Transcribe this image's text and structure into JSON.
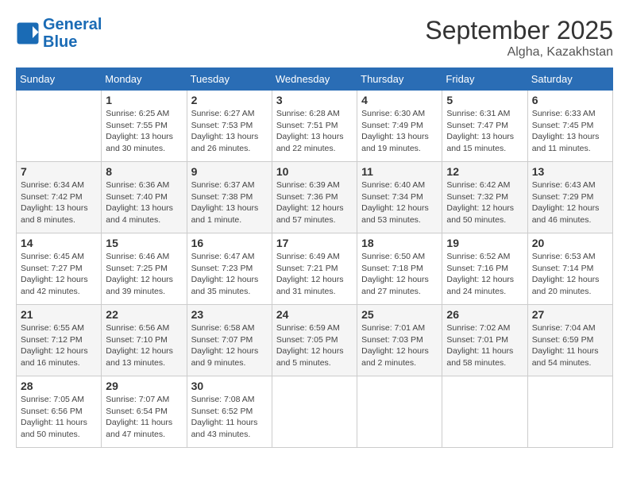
{
  "header": {
    "logo_line1": "General",
    "logo_line2": "Blue",
    "month_title": "September 2025",
    "location": "Algha, Kazakhstan"
  },
  "days_of_week": [
    "Sunday",
    "Monday",
    "Tuesday",
    "Wednesday",
    "Thursday",
    "Friday",
    "Saturday"
  ],
  "weeks": [
    [
      {
        "day": "",
        "info": ""
      },
      {
        "day": "1",
        "info": "Sunrise: 6:25 AM\nSunset: 7:55 PM\nDaylight: 13 hours\nand 30 minutes."
      },
      {
        "day": "2",
        "info": "Sunrise: 6:27 AM\nSunset: 7:53 PM\nDaylight: 13 hours\nand 26 minutes."
      },
      {
        "day": "3",
        "info": "Sunrise: 6:28 AM\nSunset: 7:51 PM\nDaylight: 13 hours\nand 22 minutes."
      },
      {
        "day": "4",
        "info": "Sunrise: 6:30 AM\nSunset: 7:49 PM\nDaylight: 13 hours\nand 19 minutes."
      },
      {
        "day": "5",
        "info": "Sunrise: 6:31 AM\nSunset: 7:47 PM\nDaylight: 13 hours\nand 15 minutes."
      },
      {
        "day": "6",
        "info": "Sunrise: 6:33 AM\nSunset: 7:45 PM\nDaylight: 13 hours\nand 11 minutes."
      }
    ],
    [
      {
        "day": "7",
        "info": "Sunrise: 6:34 AM\nSunset: 7:42 PM\nDaylight: 13 hours\nand 8 minutes."
      },
      {
        "day": "8",
        "info": "Sunrise: 6:36 AM\nSunset: 7:40 PM\nDaylight: 13 hours\nand 4 minutes."
      },
      {
        "day": "9",
        "info": "Sunrise: 6:37 AM\nSunset: 7:38 PM\nDaylight: 13 hours\nand 1 minute."
      },
      {
        "day": "10",
        "info": "Sunrise: 6:39 AM\nSunset: 7:36 PM\nDaylight: 12 hours\nand 57 minutes."
      },
      {
        "day": "11",
        "info": "Sunrise: 6:40 AM\nSunset: 7:34 PM\nDaylight: 12 hours\nand 53 minutes."
      },
      {
        "day": "12",
        "info": "Sunrise: 6:42 AM\nSunset: 7:32 PM\nDaylight: 12 hours\nand 50 minutes."
      },
      {
        "day": "13",
        "info": "Sunrise: 6:43 AM\nSunset: 7:29 PM\nDaylight: 12 hours\nand 46 minutes."
      }
    ],
    [
      {
        "day": "14",
        "info": "Sunrise: 6:45 AM\nSunset: 7:27 PM\nDaylight: 12 hours\nand 42 minutes."
      },
      {
        "day": "15",
        "info": "Sunrise: 6:46 AM\nSunset: 7:25 PM\nDaylight: 12 hours\nand 39 minutes."
      },
      {
        "day": "16",
        "info": "Sunrise: 6:47 AM\nSunset: 7:23 PM\nDaylight: 12 hours\nand 35 minutes."
      },
      {
        "day": "17",
        "info": "Sunrise: 6:49 AM\nSunset: 7:21 PM\nDaylight: 12 hours\nand 31 minutes."
      },
      {
        "day": "18",
        "info": "Sunrise: 6:50 AM\nSunset: 7:18 PM\nDaylight: 12 hours\nand 27 minutes."
      },
      {
        "day": "19",
        "info": "Sunrise: 6:52 AM\nSunset: 7:16 PM\nDaylight: 12 hours\nand 24 minutes."
      },
      {
        "day": "20",
        "info": "Sunrise: 6:53 AM\nSunset: 7:14 PM\nDaylight: 12 hours\nand 20 minutes."
      }
    ],
    [
      {
        "day": "21",
        "info": "Sunrise: 6:55 AM\nSunset: 7:12 PM\nDaylight: 12 hours\nand 16 minutes."
      },
      {
        "day": "22",
        "info": "Sunrise: 6:56 AM\nSunset: 7:10 PM\nDaylight: 12 hours\nand 13 minutes."
      },
      {
        "day": "23",
        "info": "Sunrise: 6:58 AM\nSunset: 7:07 PM\nDaylight: 12 hours\nand 9 minutes."
      },
      {
        "day": "24",
        "info": "Sunrise: 6:59 AM\nSunset: 7:05 PM\nDaylight: 12 hours\nand 5 minutes."
      },
      {
        "day": "25",
        "info": "Sunrise: 7:01 AM\nSunset: 7:03 PM\nDaylight: 12 hours\nand 2 minutes."
      },
      {
        "day": "26",
        "info": "Sunrise: 7:02 AM\nSunset: 7:01 PM\nDaylight: 11 hours\nand 58 minutes."
      },
      {
        "day": "27",
        "info": "Sunrise: 7:04 AM\nSunset: 6:59 PM\nDaylight: 11 hours\nand 54 minutes."
      }
    ],
    [
      {
        "day": "28",
        "info": "Sunrise: 7:05 AM\nSunset: 6:56 PM\nDaylight: 11 hours\nand 50 minutes."
      },
      {
        "day": "29",
        "info": "Sunrise: 7:07 AM\nSunset: 6:54 PM\nDaylight: 11 hours\nand 47 minutes."
      },
      {
        "day": "30",
        "info": "Sunrise: 7:08 AM\nSunset: 6:52 PM\nDaylight: 11 hours\nand 43 minutes."
      },
      {
        "day": "",
        "info": ""
      },
      {
        "day": "",
        "info": ""
      },
      {
        "day": "",
        "info": ""
      },
      {
        "day": "",
        "info": ""
      }
    ]
  ]
}
